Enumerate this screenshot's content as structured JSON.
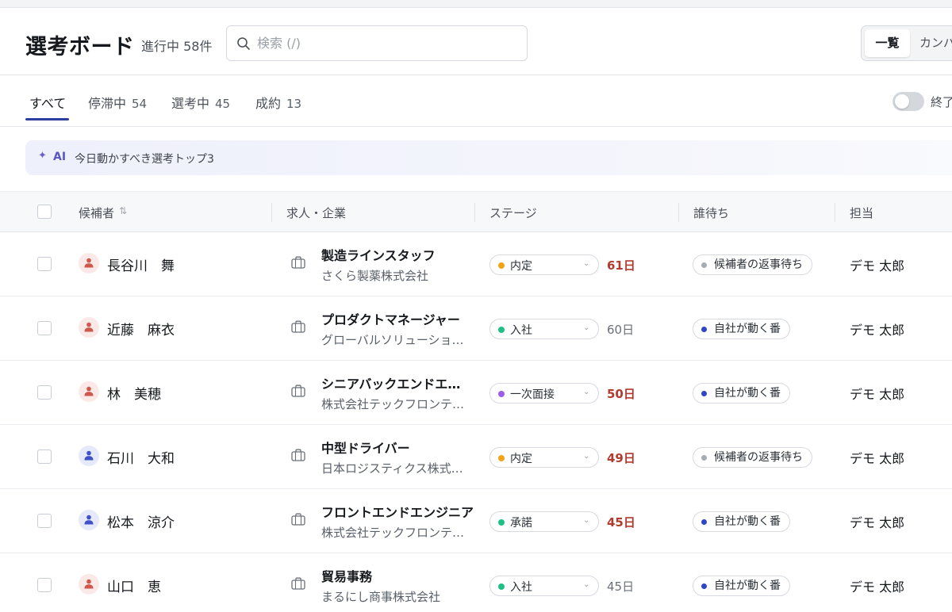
{
  "header": {
    "title": "選考ボード",
    "count": "進行中 58件",
    "search_placeholder": "検索 (/)",
    "view_options": [
      "一覧",
      "カンバン"
    ]
  },
  "tabs": [
    {
      "label": "すべて",
      "count": ""
    },
    {
      "label": "停滞中",
      "count": "54"
    },
    {
      "label": "選考中",
      "count": "45"
    },
    {
      "label": "成約",
      "count": "13"
    }
  ],
  "toggle_label": "終了",
  "ai_banner": {
    "tag": "AI",
    "text": "今日動かすべき選考トップ3"
  },
  "columns": {
    "candidate": "候補者",
    "job_company": "求人・企業",
    "stage": "ステージ",
    "waiting": "誰待ち",
    "owner": "担当"
  },
  "colors": {
    "female_avatar_bg": "#fbe9e7",
    "female_avatar_fg": "#d0574b",
    "male_avatar_bg": "#e6e9fa",
    "male_avatar_fg": "#3f51c8",
    "stage_naitei": "#f2a316",
    "stage_nyusha": "#1fbf86",
    "stage_mensetsu": "#9b5ce6",
    "stage_shodaku": "#1fbf86",
    "waiting_candidate": "#a7abb2",
    "waiting_self": "#2f46c6",
    "days_alert": "#b23a2e"
  },
  "rows": [
    {
      "name": "長谷川　舞",
      "avatar_type": "female",
      "job": "製造ラインスタッフ",
      "company": "さくら製薬株式会社",
      "stage": "内定",
      "stage_color": "#f2a316",
      "days": "61日",
      "days_alert": true,
      "waiting": "候補者の返事待ち",
      "waiting_color": "#a7abb2",
      "owner": "デモ 太郎"
    },
    {
      "name": "近藤　麻衣",
      "avatar_type": "female",
      "job": "プロダクトマネージャー",
      "company": "グローバルソリューショ…",
      "stage": "入社",
      "stage_color": "#1fbf86",
      "days": "60日",
      "days_alert": false,
      "waiting": "自社が動く番",
      "waiting_color": "#2f46c6",
      "owner": "デモ 太郎"
    },
    {
      "name": "林　美穂",
      "avatar_type": "female",
      "job": "シニアバックエンドエ…",
      "company": "株式会社テックフロンテ…",
      "stage": "一次面接",
      "stage_color": "#9b5ce6",
      "days": "50日",
      "days_alert": true,
      "waiting": "自社が動く番",
      "waiting_color": "#2f46c6",
      "owner": "デモ 太郎"
    },
    {
      "name": "石川　大和",
      "avatar_type": "male",
      "job": "中型ドライバー",
      "company": "日本ロジスティクス株式…",
      "stage": "内定",
      "stage_color": "#f2a316",
      "days": "49日",
      "days_alert": true,
      "waiting": "候補者の返事待ち",
      "waiting_color": "#a7abb2",
      "owner": "デモ 太郎"
    },
    {
      "name": "松本　涼介",
      "avatar_type": "male",
      "job": "フロントエンドエンジニア",
      "company": "株式会社テックフロンテ…",
      "stage": "承諾",
      "stage_color": "#1fbf86",
      "days": "45日",
      "days_alert": true,
      "waiting": "自社が動く番",
      "waiting_color": "#2f46c6",
      "owner": "デモ 太郎"
    },
    {
      "name": "山口　恵",
      "avatar_type": "female",
      "job": "貿易事務",
      "company": "まるにし商事株式会社",
      "stage": "入社",
      "stage_color": "#1fbf86",
      "days": "45日",
      "days_alert": false,
      "waiting": "自社が動く番",
      "waiting_color": "#2f46c6",
      "owner": "デモ 太郎"
    }
  ]
}
